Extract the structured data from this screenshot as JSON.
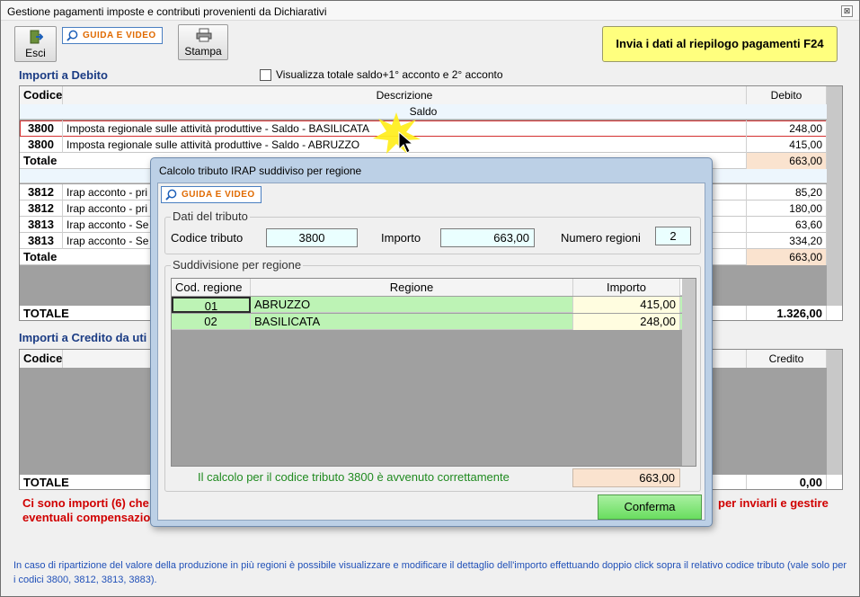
{
  "window": {
    "title": "Gestione pagamenti imposte e contributi provenienti da Dichiarativi",
    "close_glyph": "⊠"
  },
  "toolbar": {
    "esci_label": "Esci",
    "guida_label": "GUIDA E VIDEO",
    "stampa_label": "Stampa",
    "invia_label": "Invia i dati al riepilogo pagamenti F24"
  },
  "debito": {
    "section_title": "Importi a Debito",
    "checkbox_label": "Visualizza totale saldo+1° acconto e 2° acconto",
    "columns": {
      "codice": "Codice",
      "descrizione": "Descrizione",
      "debito": "Debito"
    },
    "group_saldo": "Saldo",
    "saldo_rows": [
      {
        "codice": "3800",
        "descrizione": "Imposta regionale sulle attività produttive - Saldo - BASILICATA",
        "debito": "248,00"
      },
      {
        "codice": "3800",
        "descrizione": "Imposta regionale sulle attività produttive - Saldo - ABRUZZO",
        "debito": "415,00"
      }
    ],
    "saldo_total_label": "Totale",
    "saldo_total": "663,00",
    "acconto_rows": [
      {
        "codice": "3812",
        "descrizione": "Irap acconto - pri",
        "debito": "85,20"
      },
      {
        "codice": "3812",
        "descrizione": "Irap acconto - pri",
        "debito": "180,00"
      },
      {
        "codice": "3813",
        "descrizione": "Irap acconto - Se",
        "debito": "63,60"
      },
      {
        "codice": "3813",
        "descrizione": "Irap acconto - Se",
        "debito": "334,20"
      }
    ],
    "acconto_total_label": "Totale",
    "acconto_total": "663,00",
    "grand_total_label": "TOTALE",
    "grand_total": "1.326,00"
  },
  "credito": {
    "section_title": "Importi a Credito da uti",
    "columns": {
      "codice": "Codice",
      "credito": "Credito"
    },
    "total_label": "TOTALE",
    "total": "0,00"
  },
  "warning": {
    "line1_left": "Ci sono importi (6) che",
    "line1_right": "per inviarli e gestire",
    "line2_left": "eventuali compensazio"
  },
  "info_text": "In caso di ripartizione del valore della produzione in più regioni è possibile visualizzare e modificare il dettaglio dell'importo effettuando doppio click sopra il relativo codice tributo (vale solo per i codici 3800, 3812, 3813, 3883).",
  "dialog": {
    "title": "Calcolo tributo IRAP suddiviso per regione",
    "guida_label": "GUIDA E VIDEO",
    "dati_group": "Dati del tributo",
    "codice_tributo_label": "Codice tributo",
    "codice_tributo": "3800",
    "importo_label": "Importo",
    "importo": "663,00",
    "numero_regioni_label": "Numero regioni",
    "numero_regioni": "2",
    "suddivisione_group": "Suddivisione per regione",
    "columns": {
      "cod": "Cod. regione",
      "regione": "Regione",
      "importo": "Importo"
    },
    "rows": [
      {
        "cod": "01",
        "regione": "ABRUZZO",
        "importo": "415,00"
      },
      {
        "cod": "02",
        "regione": "BASILICATA",
        "importo": "248,00"
      }
    ],
    "result_message": "Il calcolo per il codice tributo 3800 è avvenuto correttamente",
    "result_total": "663,00",
    "conferma_label": "Conferma"
  },
  "colors": {
    "section_title": "#1b3c84",
    "warning": "#d00000",
    "info": "#2050b8",
    "invia_bg": "#ffff7e",
    "region_row": "#bdf3b5",
    "total_bg": "#fae3cf",
    "ok_text": "#1f8a1f"
  }
}
